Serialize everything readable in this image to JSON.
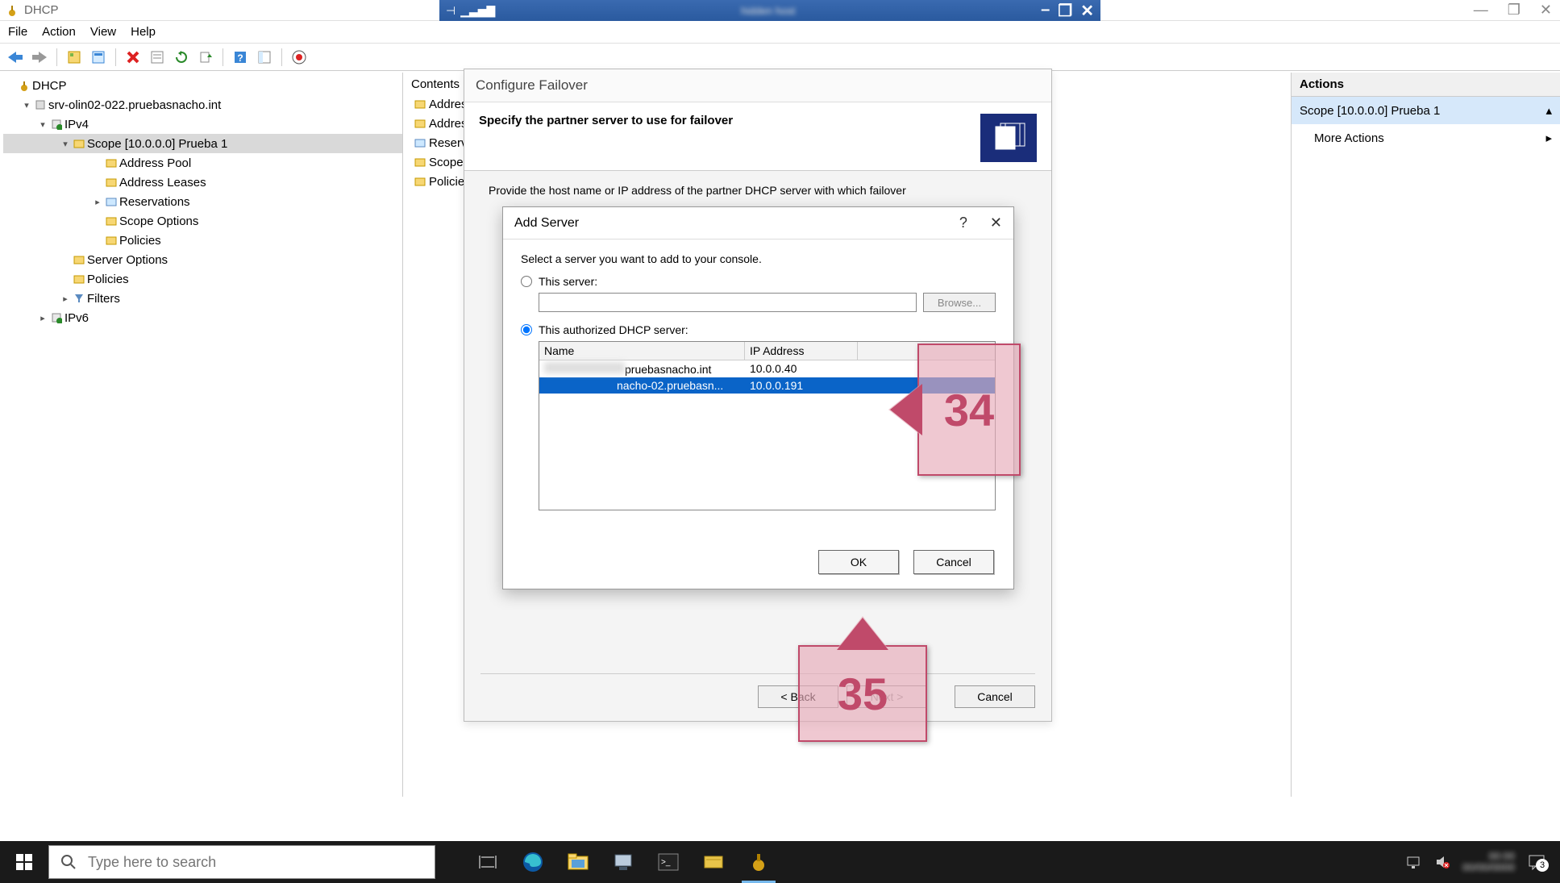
{
  "outerWindow": {
    "title": "DHCP",
    "controls": {
      "min": "—",
      "max": "❐",
      "close": "✕"
    }
  },
  "innerWindow": {
    "controls": {
      "min": "–",
      "restore": "❐",
      "close": "✕"
    }
  },
  "menubar": [
    "File",
    "Action",
    "View",
    "Help"
  ],
  "tree": {
    "root": "DHCP",
    "server": "srv-olin02-022.pruebasnacho.int",
    "ipv4": "IPv4",
    "scope": "Scope [10.0.0.0] Prueba 1",
    "scope_children": [
      "Address Pool",
      "Address Leases",
      "Reservations",
      "Scope Options",
      "Policies"
    ],
    "ipv4_extra": [
      "Server Options",
      "Policies",
      "Filters"
    ],
    "ipv6": "IPv6"
  },
  "content": {
    "header": "Contents",
    "items": [
      "Address",
      "Address",
      "Reservations",
      "Scope",
      "Policies"
    ]
  },
  "actions": {
    "header": "Actions",
    "scope": "Scope [10.0.0.0] Prueba 1",
    "more": "More Actions"
  },
  "wizard": {
    "title": "Configure Failover",
    "heading": "Specify the partner server to use for failover",
    "instruction": "Provide the host name or IP address of the partner DHCP server with which failover",
    "back": "< Back",
    "next": "Next >",
    "cancel": "Cancel"
  },
  "addServer": {
    "title": "Add Server",
    "help": "?",
    "close": "✕",
    "prompt": "Select a server you want to add to your console.",
    "radio_this": "This server:",
    "browse": "Browse...",
    "radio_auth": "This authorized DHCP server:",
    "col_name": "Name",
    "col_ip": "IP Address",
    "rows": [
      {
        "name": "pruebasnacho.int",
        "ip": "10.0.0.40",
        "selected": false
      },
      {
        "name": "nacho-02.pruebasn...",
        "ip": "10.0.0.191",
        "selected": true
      }
    ],
    "ok": "OK",
    "cancel": "Cancel"
  },
  "annotations": {
    "a34": "34",
    "a35": "35"
  },
  "taskbar": {
    "search_placeholder": "Type here to search",
    "notif_count": "3"
  }
}
